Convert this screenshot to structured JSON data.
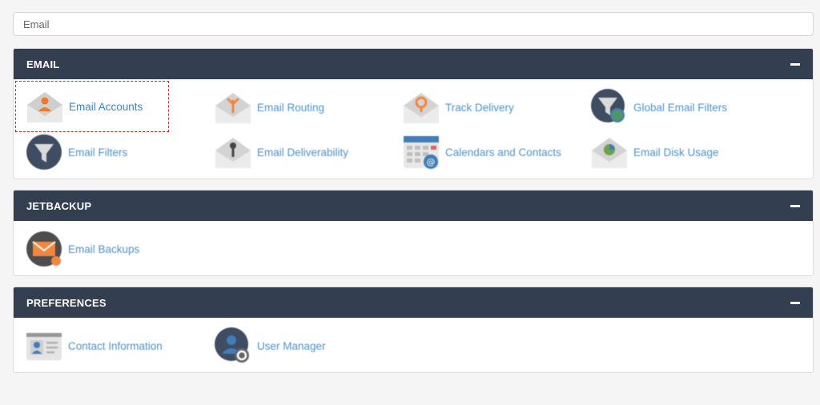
{
  "search": {
    "value": "Email"
  },
  "sections": {
    "email": {
      "title": "EMAIL",
      "items": [
        {
          "label": "Email Accounts"
        },
        {
          "label": "Email Routing"
        },
        {
          "label": "Track Delivery"
        },
        {
          "label": "Global Email Filters"
        },
        {
          "label": "Email Filters"
        },
        {
          "label": "Email Deliverability"
        },
        {
          "label": "Calendars and Contacts"
        },
        {
          "label": "Email Disk Usage"
        }
      ]
    },
    "jetbackup": {
      "title": "JETBACKUP",
      "items": [
        {
          "label": "Email Backups"
        }
      ]
    },
    "preferences": {
      "title": "PREFERENCES",
      "items": [
        {
          "label": "Contact Information"
        },
        {
          "label": "User Manager"
        }
      ]
    }
  },
  "colors": {
    "header": "#333f50",
    "link": "#3a86c8",
    "accent_orange": "#f07a2a",
    "selection_border": "#c9302c"
  }
}
